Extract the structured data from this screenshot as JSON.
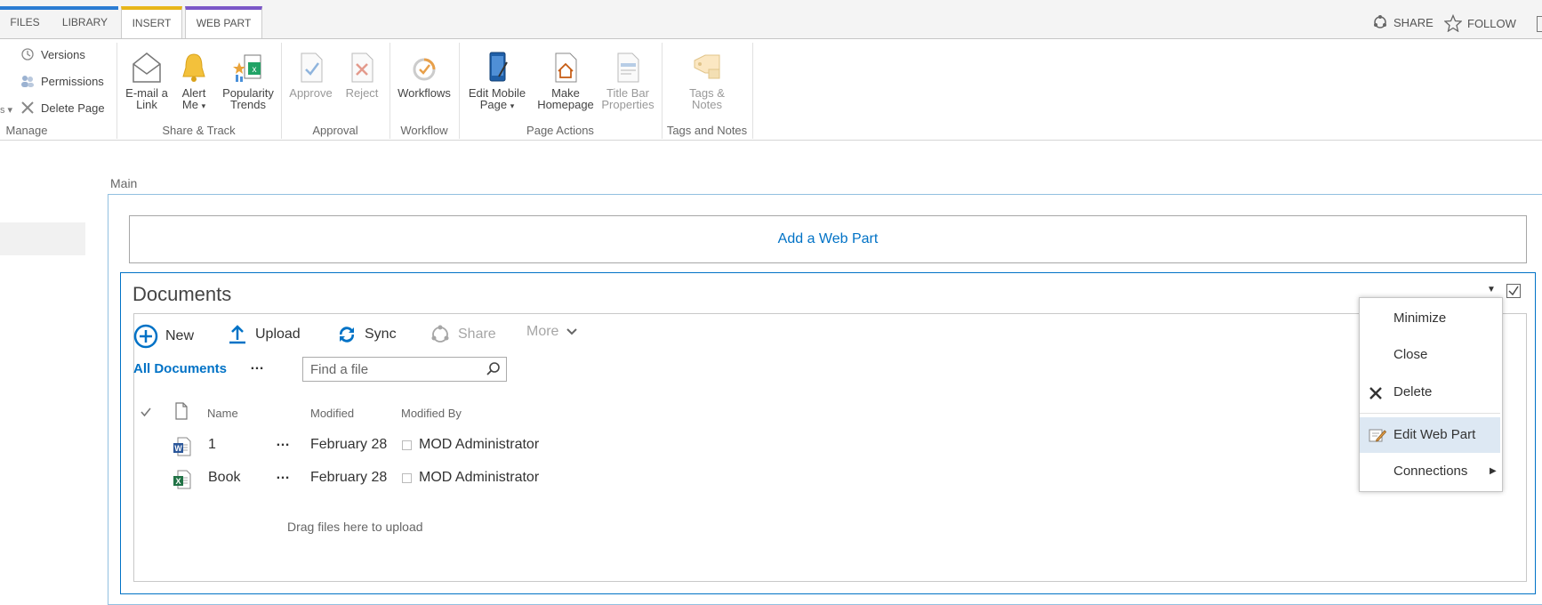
{
  "tabs": [
    {
      "label": "FILES"
    },
    {
      "label": "LIBRARY"
    },
    {
      "label": "INSERT",
      "color": "#e8b618"
    },
    {
      "label": "WEB PART",
      "color": "#7b57c7"
    }
  ],
  "toplinks": {
    "share": "SHARE",
    "follow": "FOLLOW"
  },
  "ribbon": {
    "manage": {
      "versions": "Versions",
      "permissions": "Permissions",
      "delete_page": "Delete Page",
      "label": "Manage"
    },
    "share_track": {
      "email_1": "E-mail a",
      "email_2": "Link",
      "alert_1": "Alert",
      "alert_2": "Me",
      "pop_1": "Popularity",
      "pop_2": "Trends",
      "label": "Share & Track"
    },
    "approval": {
      "approve": "Approve",
      "reject": "Reject",
      "label": "Approval"
    },
    "workflow": {
      "workflows": "Workflows",
      "label": "Workflow"
    },
    "page_actions": {
      "mobile_1": "Edit Mobile",
      "mobile_2": "Page",
      "home_1": "Make",
      "home_2": "Homepage",
      "title_1": "Title Bar",
      "title_2": "Properties",
      "label": "Page Actions"
    },
    "tags": {
      "t1": "Tags &",
      "t2": "Notes",
      "label": "Tags and Notes"
    }
  },
  "zone_label": "Main",
  "add_web_part": "Add a Web Part",
  "webpart": {
    "title": "Documents",
    "commands": {
      "new": "New",
      "upload": "Upload",
      "sync": "Sync",
      "share": "Share",
      "more": "More"
    },
    "view": "All Documents",
    "ellipsis": "…",
    "search_placeholder": "Find a file",
    "columns": {
      "name": "Name",
      "modified": "Modified",
      "modified_by": "Modified By"
    },
    "rows": [
      {
        "name": "1",
        "modified": "February 28",
        "modified_by": "MOD Administrator",
        "icon": "word-doc-icon"
      },
      {
        "name": "Book",
        "modified": "February 28",
        "modified_by": "MOD Administrator",
        "icon": "excel-doc-icon"
      }
    ],
    "drag_text": "Drag files here to upload"
  },
  "menu": {
    "minimize": "Minimize",
    "close": "Close",
    "delete": "Delete",
    "edit": "Edit Web Part",
    "connections": "Connections"
  },
  "colors": {
    "accent": "#0072c6",
    "files_tab": "#2b7cd3",
    "selected_menu": "#dde8f3"
  }
}
